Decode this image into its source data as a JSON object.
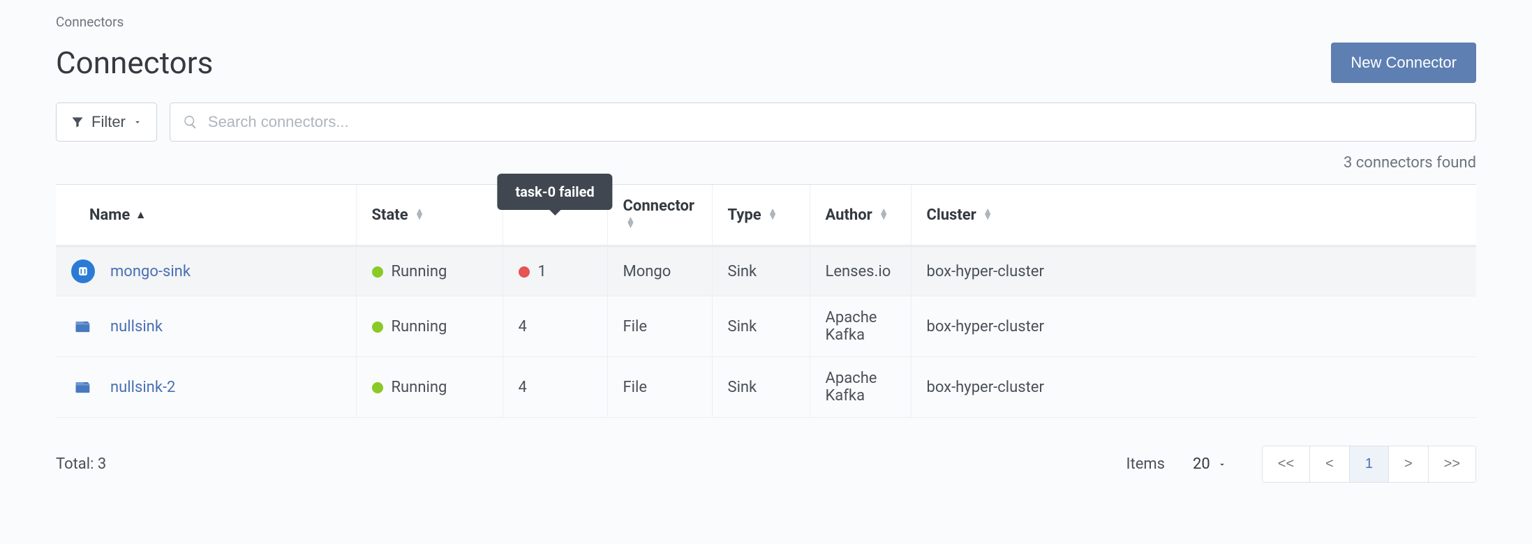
{
  "breadcrumb": "Connectors",
  "pageTitle": "Connectors",
  "newConnectorLabel": "New Connector",
  "filterLabel": "Filter",
  "searchPlaceholder": "Search connectors...",
  "foundText": "3 connectors found",
  "tooltipText": "task-0 failed",
  "columns": {
    "name": "Name",
    "state": "State",
    "tasks": "",
    "connector": "Connector",
    "type": "Type",
    "author": "Author",
    "cluster": "Cluster"
  },
  "rows": [
    {
      "name": "mongo-sink",
      "state": "Running",
      "stateColor": "green",
      "tasks": "1",
      "tasksColor": "red",
      "connector": "Mongo",
      "type": "Sink",
      "author": "Lenses.io",
      "cluster": "box-hyper-cluster",
      "iconType": "mongo",
      "highlight": true
    },
    {
      "name": "nullsink",
      "state": "Running",
      "stateColor": "green",
      "tasks": "4",
      "tasksColor": "none",
      "connector": "File",
      "type": "Sink",
      "author": "Apache Kafka",
      "cluster": "box-hyper-cluster",
      "iconType": "file",
      "highlight": false
    },
    {
      "name": "nullsink-2",
      "state": "Running",
      "stateColor": "green",
      "tasks": "4",
      "tasksColor": "none",
      "connector": "File",
      "type": "Sink",
      "author": "Apache Kafka",
      "cluster": "box-hyper-cluster",
      "iconType": "file",
      "highlight": false
    }
  ],
  "totalLabel": "Total: 3",
  "itemsLabel": "Items",
  "itemsValue": "20",
  "pager": {
    "first": "<<",
    "prev": "<",
    "current": "1",
    "next": ">",
    "last": ">>"
  }
}
